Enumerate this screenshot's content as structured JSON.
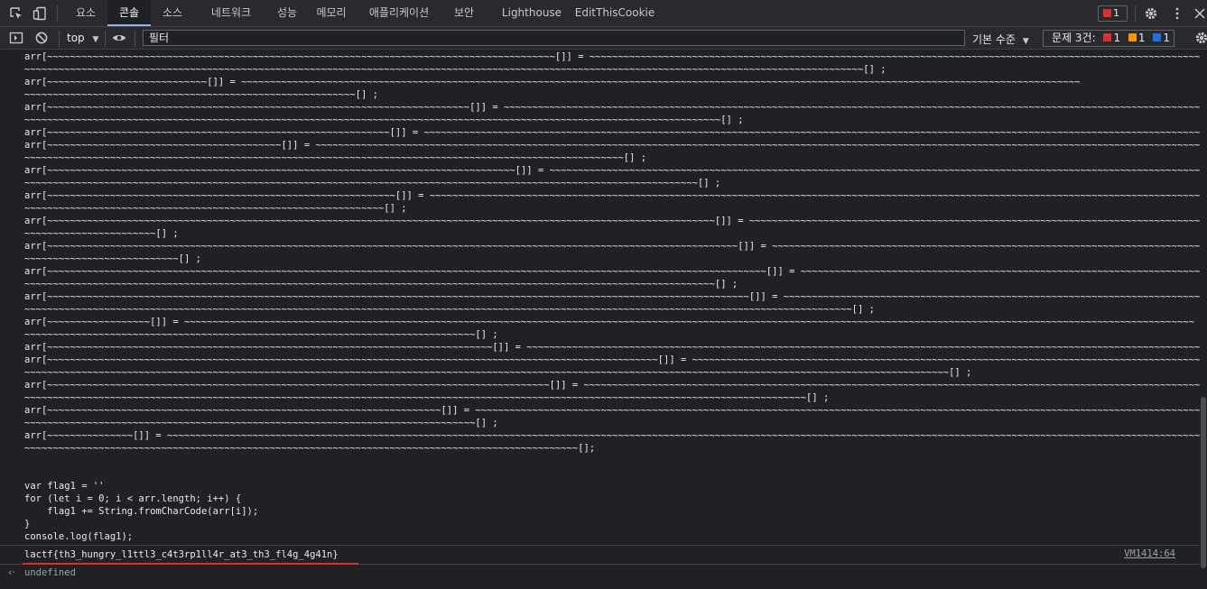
{
  "tabs": [
    {
      "label": "요소"
    },
    {
      "label": "콘솔",
      "active": true
    },
    {
      "label": "소스"
    },
    {
      "label": "네트워크"
    },
    {
      "label": "성능"
    },
    {
      "label": "메모리"
    },
    {
      "label": "애플리케이션"
    },
    {
      "label": "보안"
    },
    {
      "label": "Lighthouse"
    },
    {
      "label": "EditThisCookie"
    }
  ],
  "error_badge_count": "1",
  "toolbar": {
    "context": "top",
    "filter_placeholder": "필터",
    "levels": "기본 수준",
    "issues_label": "문제 3건:",
    "issue_error_count": "1",
    "issue_warning_count": "1",
    "issue_info_count": "1"
  },
  "console": {
    "code": "arr[~~~~~~~~~~~~~~~~~~~~~~~~~~~~~~~~~~~~~~~~~~~~~~~~~~~~~~~~~~~~~~~~~~~~~~~~~~~~~~~~~~~~~~~~~[]] = ~~~~~~~~~~~~~~~~~~~~~~~~~~~~~~~~~~~~~~~~~~~~~~~~~~~~~~~~~~~~~~~~~~~~~~~~~~~~~~~~~~~~~~~~~~~~~~~~~~~~~~~~~~~~~~~~~~~~\n~~~~~~~~~~~~~~~~~~~~~~~~~~~~~~~~~~~~~~~~~~~~~~~~~~~~~~~~~~~~~~~~~~~~~~~~~~~~~~~~~~~~~~~~~~~~~~~~~~~~~~~~~~~~~~~~~~~~~~~~~~~~~~~~~~~~~~~~~~~~~~~~~~~[] ;\narr[~~~~~~~~~~~~~~~~~~~~~~~~~~~~[]] = ~~~~~~~~~~~~~~~~~~~~~~~~~~~~~~~~~~~~~~~~~~~~~~~~~~~~~~~~~~~~~~~~~~~~~~~~~~~~~~~~~~~~~~~~~~~~~~~~~~~~~~~~~~~~~~~~~~~~~~~~~~~~~~~~~~~~~~~~~~~~~~~~~~~\n~~~~~~~~~~~~~~~~~~~~~~~~~~~~~~~~~~~~~~~~~~~~~~~~~~~~~~~~~~[] ;\narr[~~~~~~~~~~~~~~~~~~~~~~~~~~~~~~~~~~~~~~~~~~~~~~~~~~~~~~~~~~~~~~~~~~~~~~~~~~[]] = ~~~~~~~~~~~~~~~~~~~~~~~~~~~~~~~~~~~~~~~~~~~~~~~~~~~~~~~~~~~~~~~~~~~~~~~~~~~~~~~~~~~~~~~~~~~~~~~~~~~~~~~~~~~~~~~~~~~~~~~~~~~~~~~~~~~~~~~~\n~~~~~~~~~~~~~~~~~~~~~~~~~~~~~~~~~~~~~~~~~~~~~~~~~~~~~~~~~~~~~~~~~~~~~~~~~~~~~~~~~~~~~~~~~~~~~~~~~~~~~~~~~~~~~~~~~~~~~~~~~~[] ;\narr[~~~~~~~~~~~~~~~~~~~~~~~~~~~~~~~~~~~~~~~~~~~~~~~~~~~~~~~~~~~~[]] = ~~~~~~~~~~~~~~~~~~~~~~~~~~~~~~~~~~~~~~~~~~~~~~~~~~~~~~~~~~~~~~~~~~~~~~~~~~~~~~~~~~~~~~~~~~~~~~~~~~~~~~~~~~~~~~~~~~~~~~~~~~~~~~~~~~~~~~~~~~~~~~~[] ;\narr[~~~~~~~~~~~~~~~~~~~~~~~~~~~~~~~~~~~~~~~~~[]] = ~~~~~~~~~~~~~~~~~~~~~~~~~~~~~~~~~~~~~~~~~~~~~~~~~~~~~~~~~~~~~~~~~~~~~~~~~~~~~~~~~~~~~~~~~~~~~~~~~~~~~~~~~~~~~~~~~~~~~~~~~~~~~~~~~~~~~~~~~~~~~~~~~~~~~~~~~~~~~~~~~~~~~~~\n~~~~~~~~~~~~~~~~~~~~~~~~~~~~~~~~~~~~~~~~~~~~~~~~~~~~~~~~~~~~~~~~~~~~~~~~~~~~~~~~~~~~~~~~~~~~~~~~~~~~~~~~~[] ;\narr[~~~~~~~~~~~~~~~~~~~~~~~~~~~~~~~~~~~~~~~~~~~~~~~~~~~~~~~~~~~~~~~~~~~~~~~~~~~~~~~~~~[]] = ~~~~~~~~~~~~~~~~~~~~~~~~~~~~~~~~~~~~~~~~~~~~~~~~~~~~~~~~~~~~~~~~~~~~~~~~~~~~~~~~~~~~~~~~~~~~~~~~~~~~~~~~~~~~~~~~~~~~~~~~~~~~~~~~~~~~~\n~~~~~~~~~~~~~~~~~~~~~~~~~~~~~~~~~~~~~~~~~~~~~~~~~~~~~~~~~~~~~~~~~~~~~~~~~~~~~~~~~~~~~~~~~~~~~~~~~~~~~~~~~~~~~~~~~~~~~~[] ;\narr[~~~~~~~~~~~~~~~~~~~~~~~~~~~~~~~~~~~~~~~~~~~~~~~~~~~~~~~~~~~~~[]] = ~~~~~~~~~~~~~~~~~~~~~~~~~~~~~~~~~~~~~~~~~~~~~~~~~~~~~~~~~~~~~~~~~~~~~~~~~~~~~~~~~~~~~~~~~~~~~~~~~~~~~~~~~~~~~~~~~~~~~~~~~~~~~~~~~~~~~~~~~~~~~~~~~~~~~~~~~~~~~~~~~~~\n~~~~~~~~~~~~~~~~~~~~~~~~~~~~~~~~~~~~~~~~~~~~~~~~~~~~~~~~~~~~~~~[] ;\narr[~~~~~~~~~~~~~~~~~~~~~~~~~~~~~~~~~~~~~~~~~~~~~~~~~~~~~~~~~~~~~~~~~~~~~~~~~~~~~~~~~~~~~~~~~~~~~~~~~~~~~~~~~~~~~~~~~~~~~[]] = ~~~~~~~~~~~~~~~~~~~~~~~~~~~~~~~~~~~~~~~~~~~~~~~~~~~~~~~~~~~~~~~~~~~~~~~~~~~~~~~~~~~~~~~~~~~~~~~~~~~~~\n~~~~~~~~~~~~~~~~~~~~~~~[] ;\narr[~~~~~~~~~~~~~~~~~~~~~~~~~~~~~~~~~~~~~~~~~~~~~~~~~~~~~~~~~~~~~~~~~~~~~~~~~~~~~~~~~~~~~~~~~~~~~~~~~~~~~~~~~~~~~~~~~~~~~~~~~[]] = ~~~~~~~~~~~~~~~~~~~~~~~~~~~~~~~~~~~~~~~~~~~~~~~~~~~~~~~~~~~~~~~~~~~~~~~~~~~~~~~~~~~~~~~~~~~~~~~~~\n~~~~~~~~~~~~~~~~~~~~~~~~~~~[] ;\narr[~~~~~~~~~~~~~~~~~~~~~~~~~~~~~~~~~~~~~~~~~~~~~~~~~~~~~~~~~~~~~~~~~~~~~~~~~~~~~~~~~~~~~~~~~~~~~~~~~~~~~~~~~~~~~~~~~~~~~~~~~~~~~~[]] = ~~~~~~~~~~~~~~~~~~~~~~~~~~~~~~~~~~~~~~~~~~~~~~~~~~~~~~~~~~~~~~~~~~~~~~~~~~~~~~~~~~~~~~~~~~~~~~~~~~\n~~~~~~~~~~~~~~~~~~~~~~~~~~~~~~~~~~~~~~~~~~~~~~~~~~~~~~~~~~~~~~~~~~~~~~~~~~~~~~~~~~~~~~~~~~~~~~~~~~~~~~~~~~~~~~~~~~~~~~~~~[] ;\narr[~~~~~~~~~~~~~~~~~~~~~~~~~~~~~~~~~~~~~~~~~~~~~~~~~~~~~~~~~~~~~~~~~~~~~~~~~~~~~~~~~~~~~~~~~~~~~~~~~~~~~~~~~~~~~~~~~~~~~~~~~~~[]] = ~~~~~~~~~~~~~~~~~~~~~~~~~~~~~~~~~~~~~~~~~~~~~~~~~~~~~~~~~~~~~~~~~~~~~~~~~~~~~~~~~~~~~~~~~~~~~~~~~~~~~~~~~~~~~~~\n~~~~~~~~~~~~~~~~~~~~~~~~~~~~~~~~~~~~~~~~~~~~~~~~~~~~~~~~~~~~~~~~~~~~~~~~~~~~~~~~~~~~~~~~~~~~~~~~~~~~~~~~~~~~~~~~~~~~~~~~~~~~~~~~~~~~~~~~~~~~~~~~~[] ;\narr[~~~~~~~~~~~~~~~~~~[]] = ~~~~~~~~~~~~~~~~~~~~~~~~~~~~~~~~~~~~~~~~~~~~~~~~~~~~~~~~~~~~~~~~~~~~~~~~~~~~~~~~~~~~~~~~~~~~~~~~~~~~~~~~~~~~~~~~~~~~~~~~~~~~~~~~~~~~~~~~~~~~~~~~~~~~~~~~~~~~~~~~~~~~~~~~~~~~~~~~~\n~~~~~~~~~~~~~~~~~~~~~~~~~~~~~~~~~~~~~~~~~~~~~~~~~~~~~~~~~~~~~~~~~~~~~~~~~~~~~~~[] ;\narr[~~~~~~~~~~~~~~~~~~~~~~~~~~~~~~~~~~~~~~~~~~~~~~~~~~~~~~~~~~~~~~~~~~~~~~~~~~~~~~[]] = ~~~~~~~~~~~~~~~~~~~~~~~~~~~~~~~~~~~~~~~~~~~~~~~~~~~~~~~~~~~~~~~~~~~~~~~~~~~~~~~~~~~~~~~~~~~~~~~~~~~~~~~~~~~~~~~~~~~~~~~~~~~[] ;\narr[~~~~~~~~~~~~~~~~~~~~~~~~~~~~~~~~~~~~~~~~~~~~~~~~~~~~~~~~~~~~~~~~~~~~~~~~~~~~~~~~~~~~~~~~~~~~~~~~~~~~~~~~~~~[]] = ~~~~~~~~~~~~~~~~~~~~~~~~~~~~~~~~~~~~~~~~~~~~~~~~~~~~~~~~~~~~~~~~~~~~~~~~~~~~~~~~~~~~~~~~~~~~~~~~~~~~~~~~~~~~~~~~~\n~~~~~~~~~~~~~~~~~~~~~~~~~~~~~~~~~~~~~~~~~~~~~~~~~~~~~~~~~~~~~~~~~~~~~~~~~~~~~~~~~~~~~~~~~~~~~~~~~~~~~~~~~~~~~~~~~~~~~~~~~~~~~~~~~~~~~~~~~~~~~~~~~~~~~~~~~~~~~~~~~~[] ;\narr[~~~~~~~~~~~~~~~~~~~~~~~~~~~~~~~~~~~~~~~~~~~~~~~~~~~~~~~~~~~~~~~~~~~~~~~~~~~~~~~~~~~~~~~~[]] = ~~~~~~~~~~~~~~~~~~~~~~~~~~~~~~~~~~~~~~~~~~~~~~~~~~~~~~~~~~~~~~~~~~~~~~~~~~~~~~~~~~~~~~~~~~~~~~~~~~~~~~~~~~~~~~~~~~~~~~~~~~~~~~~~~~~\n~~~~~~~~~~~~~~~~~~~~~~~~~~~~~~~~~~~~~~~~~~~~~~~~~~~~~~~~~~~~~~~~~~~~~~~~~~~~~~~~~~~~~~~~~~~~~~~~~~~~~~~~~~~~~~~~~~~~~~~~~~~~~~~~~~~~~~~~~[] ;\narr[~~~~~~~~~~~~~~~~~~~~~~~~~~~~~~~~~~~~~~~~~~~~~~~~~~~~~~~~~~~~~~~~~~~~~[]] = ~~~~~~~~~~~~~~~~~~~~~~~~~~~~~~~~~~~~~~~~~~~~~~~~~~~~~~~~~~~~~~~~~~~~~~~~~~~~~~~~~~~~~~~~~~~~~~~~~~~~~~~~~~~~~~~~~~~~~~~~~~~~~~~~~~~~~~~~~~~~~~~~~~~~~~~~~~~~~~~~~~~\n~~~~~~~~~~~~~~~~~~~~~~~~~~~~~~~~~~~~~~~~~~~~~~~~~~~~~~~~~~~~~~~~~~~~~~~~~~~~~~~[] ;\narr[~~~~~~~~~~~~~~~[]] = ~~~~~~~~~~~~~~~~~~~~~~~~~~~~~~~~~~~~~~~~~~~~~~~~~~~~~~~~~~~~~~~~~~~~~~~~~~~~~~~~~~~~~~~~~~~~~~~~~~~~~~~~~~~~~~~~~~~~~~~~~~~~~~~~~~~~~~~~~~~~~~~~~~~~~~~~~~~~~~~~~~~~~~~~~~~~~~~~~~~~~\n~~~~~~~~~~~~~~~~~~~~~~~~~~~~~~~~~~~~~~~~~~~~~~~~~~~~~~~~~~~~~~~~~~~~~~~~~~~~~~~~~~~~~~~~~~~~~~~~~[];\n\n\nvar flag1 = ''\nfor (let i = 0; i < arr.length; i++) {\n    flag1 += String.fromCharCode(arr[i]);\n}\nconsole.log(flag1);",
    "output": "lactf{th3_hungry_l1ttl3_c4t3rp1ll4r_at3_th3_fl4g_4g41n}",
    "output_source": "VM1414:64",
    "return_value": "undefined"
  }
}
